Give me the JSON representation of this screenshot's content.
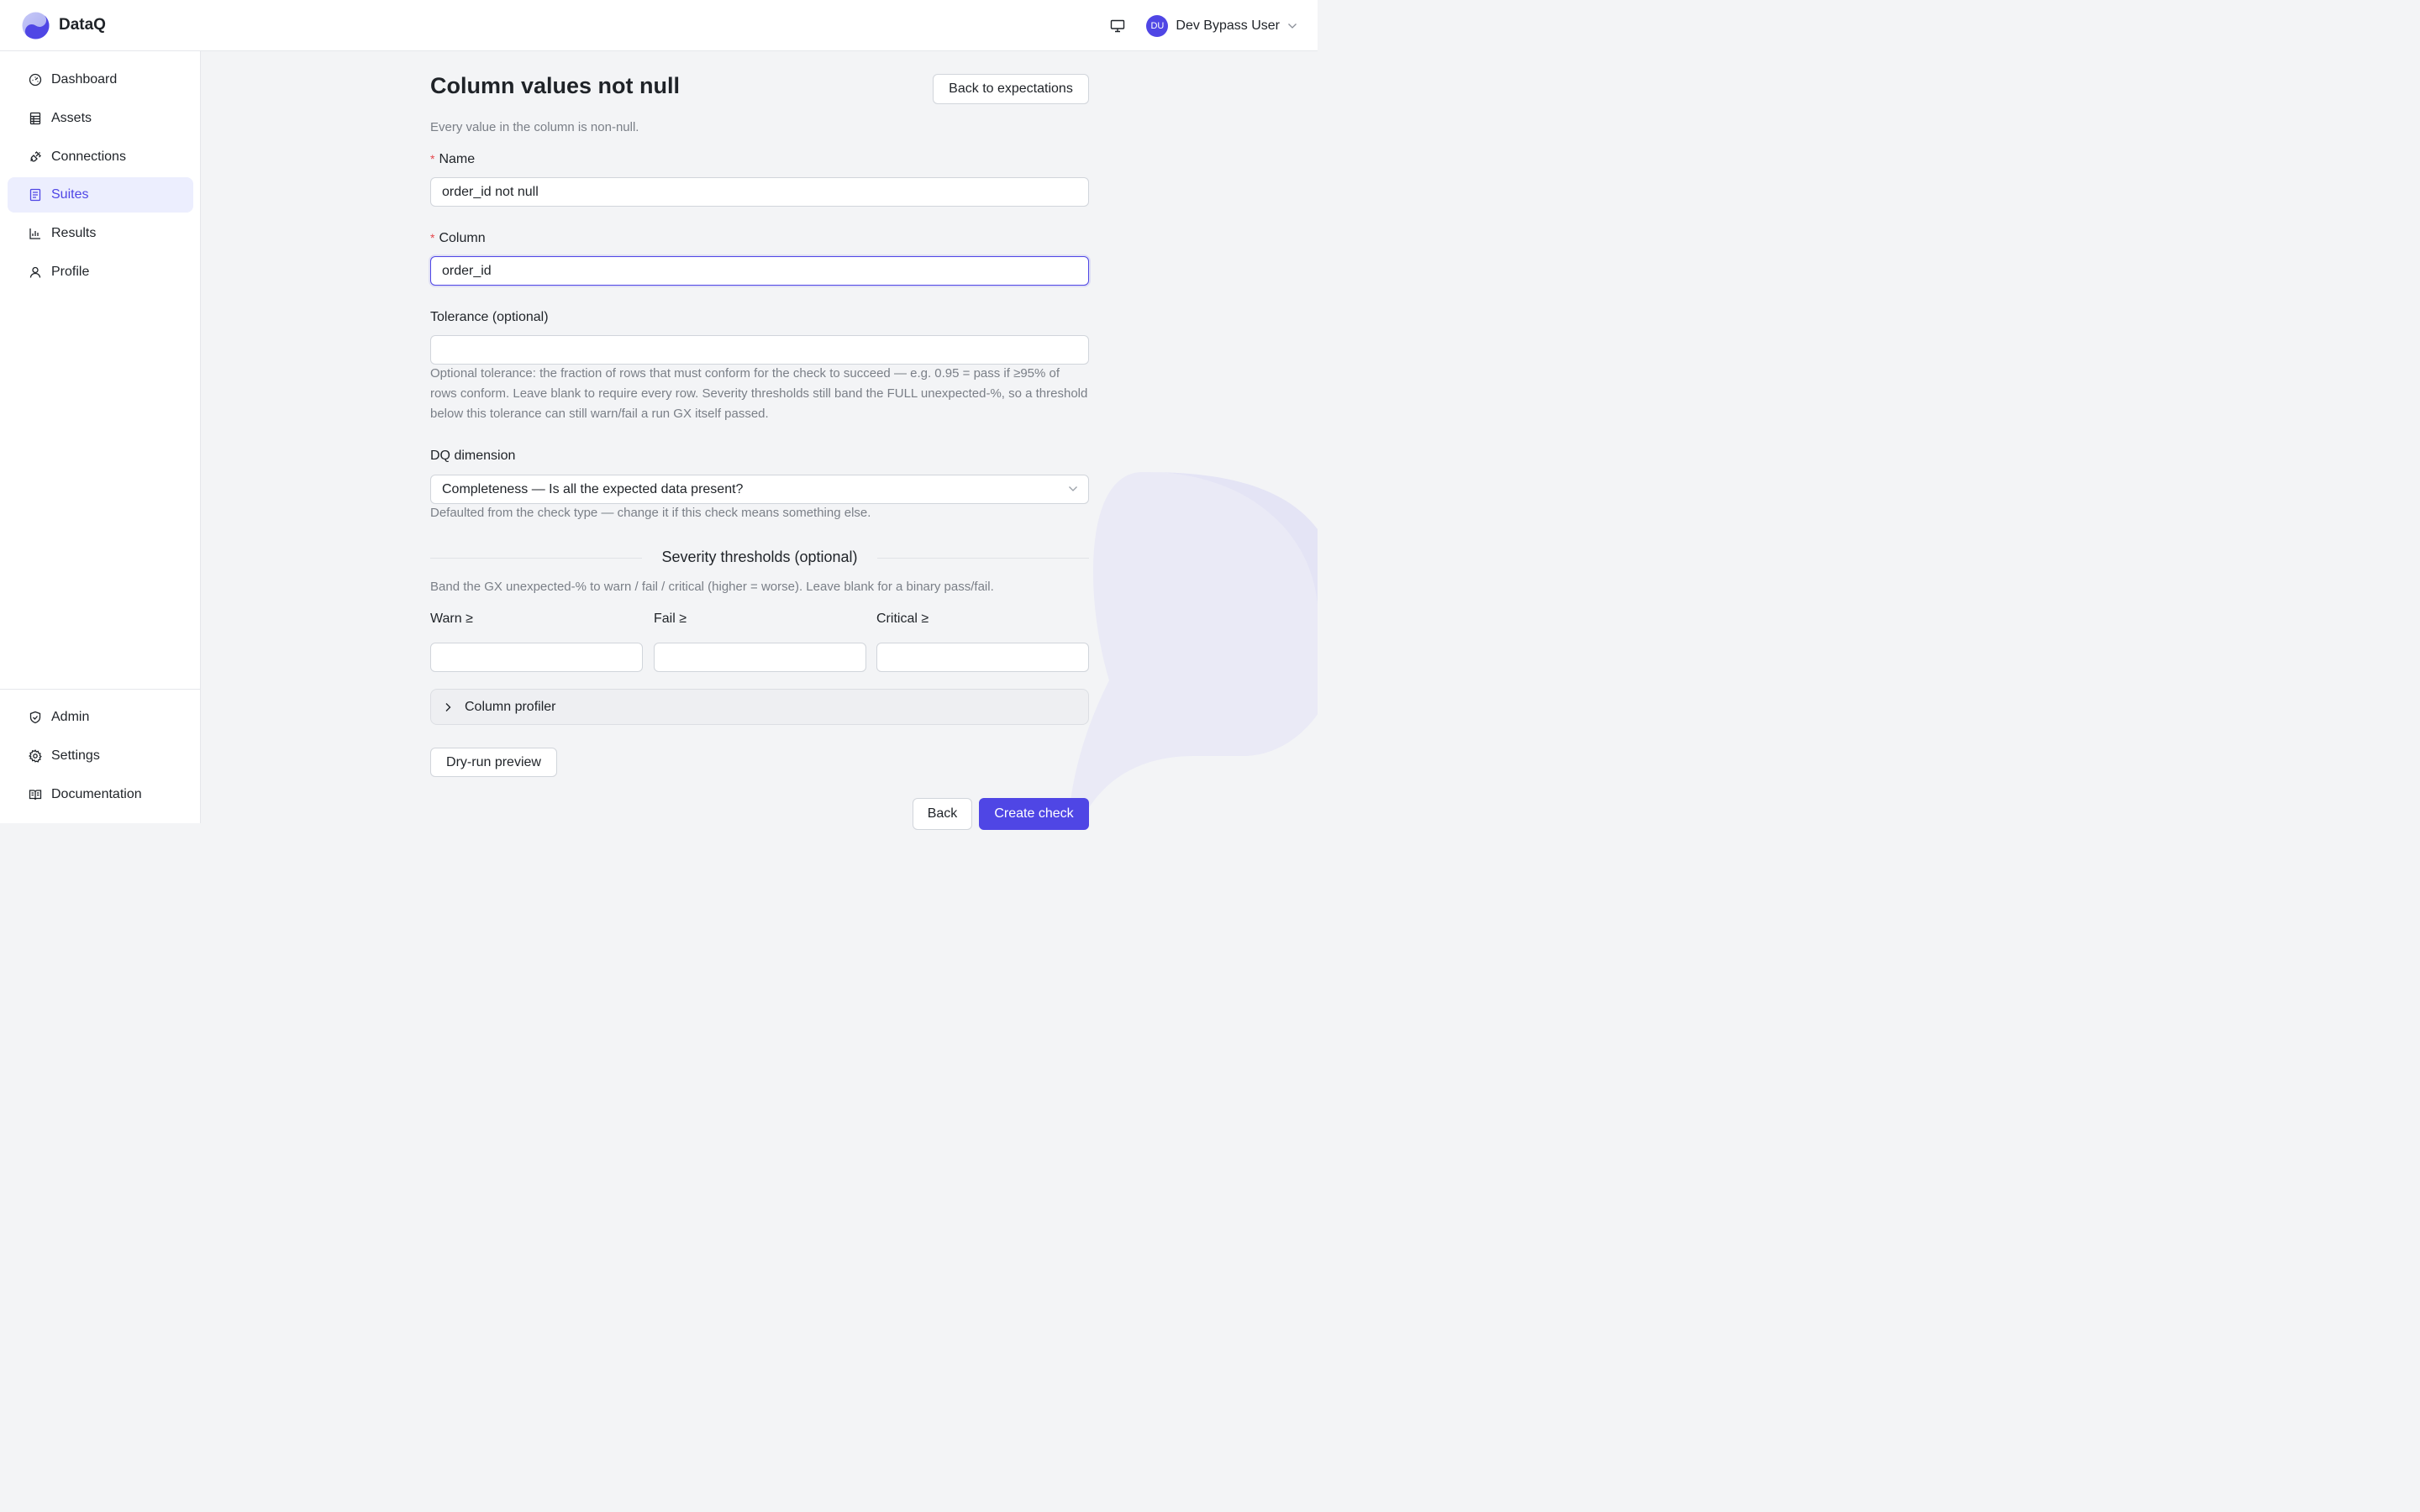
{
  "header": {
    "brand": "DataQ",
    "user": {
      "initials": "DU",
      "name": "Dev Bypass User"
    }
  },
  "sidebar": {
    "items": [
      {
        "label": "Dashboard",
        "icon": "gauge-icon"
      },
      {
        "label": "Assets",
        "icon": "table-icon"
      },
      {
        "label": "Connections",
        "icon": "plug-icon"
      },
      {
        "label": "Suites",
        "icon": "checklist-icon",
        "active": true
      },
      {
        "label": "Results",
        "icon": "bar-chart-icon"
      },
      {
        "label": "Profile",
        "icon": "user-icon"
      }
    ],
    "bottom_items": [
      {
        "label": "Admin",
        "icon": "shield-check-icon"
      },
      {
        "label": "Settings",
        "icon": "gear-icon"
      },
      {
        "label": "Documentation",
        "icon": "book-icon"
      }
    ]
  },
  "page": {
    "title": "Column values not null",
    "back_to_expectations": "Back to expectations",
    "subtitle": "Every value in the column is non-null."
  },
  "form": {
    "name": {
      "label": "Name",
      "value": "order_id not null",
      "required": true
    },
    "column": {
      "label": "Column",
      "value": "order_id",
      "required": true
    },
    "tolerance": {
      "label": "Tolerance (optional)",
      "value": "",
      "help": "Optional tolerance: the fraction of rows that must conform for the check to succeed — e.g. 0.95 = pass if ≥95% of rows conform. Leave blank to require every row. Severity thresholds still band the FULL unexpected-%, so a threshold below this tolerance can still warn/fail a run GX itself passed."
    },
    "dq_dimension": {
      "label": "DQ dimension",
      "selected": "Completeness — Is all the expected data present?",
      "help": "Defaulted from the check type — change it if this check means something else."
    },
    "severity": {
      "title": "Severity thresholds (optional)",
      "help": "Band the GX unexpected-% to warn / fail / critical (higher = worse). Leave blank for a binary pass/fail.",
      "warn_label": "Warn ≥",
      "fail_label": "Fail ≥",
      "critical_label": "Critical ≥",
      "warn_value": "",
      "fail_value": "",
      "critical_value": ""
    },
    "column_profiler": "Column profiler",
    "dry_run": "Dry-run preview",
    "back": "Back",
    "create": "Create check"
  },
  "colors": {
    "accent": "#4f46e5",
    "required": "#e5484d",
    "active_nav_bg": "#eceefe",
    "page_bg": "#f3f4f6"
  }
}
